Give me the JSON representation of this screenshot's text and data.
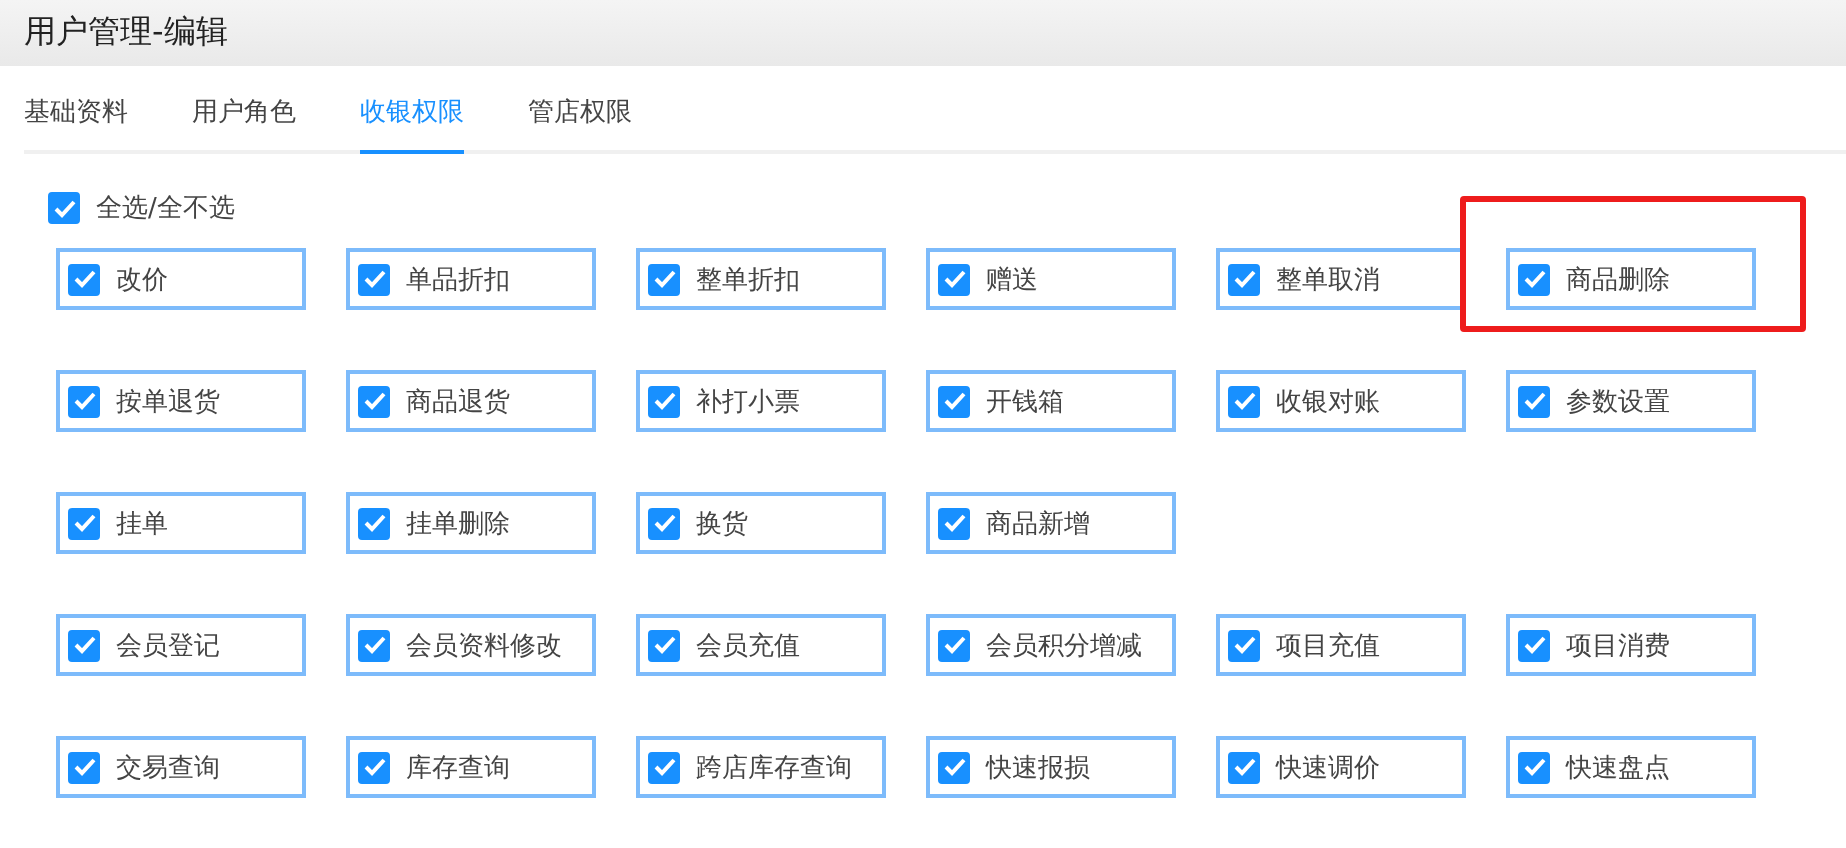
{
  "header": {
    "title": "用户管理-编辑"
  },
  "tabs": [
    {
      "label": "基础资料",
      "selected": false
    },
    {
      "label": "用户角色",
      "selected": false
    },
    {
      "label": "收银权限",
      "selected": true
    },
    {
      "label": "管店权限",
      "selected": false
    }
  ],
  "select_all": {
    "label": "全选/全不选",
    "checked": true
  },
  "permission_rows": [
    [
      {
        "label": "改价",
        "checked": true,
        "highlighted": false
      },
      {
        "label": "单品折扣",
        "checked": true,
        "highlighted": false
      },
      {
        "label": "整单折扣",
        "checked": true,
        "highlighted": false
      },
      {
        "label": "赠送",
        "checked": true,
        "highlighted": false
      },
      {
        "label": "整单取消",
        "checked": true,
        "highlighted": false
      },
      {
        "label": "商品删除",
        "checked": true,
        "highlighted": true
      }
    ],
    [
      {
        "label": "按单退货",
        "checked": true,
        "highlighted": false
      },
      {
        "label": "商品退货",
        "checked": true,
        "highlighted": false
      },
      {
        "label": "补打小票",
        "checked": true,
        "highlighted": false
      },
      {
        "label": "开钱箱",
        "checked": true,
        "highlighted": false
      },
      {
        "label": "收银对账",
        "checked": true,
        "highlighted": false
      },
      {
        "label": "参数设置",
        "checked": true,
        "highlighted": false
      }
    ],
    [
      {
        "label": "挂单",
        "checked": true,
        "highlighted": false
      },
      {
        "label": "挂单删除",
        "checked": true,
        "highlighted": false
      },
      {
        "label": "换货",
        "checked": true,
        "highlighted": false
      },
      {
        "label": "商品新增",
        "checked": true,
        "highlighted": false
      }
    ],
    [
      {
        "label": "会员登记",
        "checked": true,
        "highlighted": false
      },
      {
        "label": "会员资料修改",
        "checked": true,
        "highlighted": false
      },
      {
        "label": "会员充值",
        "checked": true,
        "highlighted": false
      },
      {
        "label": "会员积分增减",
        "checked": true,
        "highlighted": false
      },
      {
        "label": "项目充值",
        "checked": true,
        "highlighted": false
      },
      {
        "label": "项目消费",
        "checked": true,
        "highlighted": false
      }
    ],
    [
      {
        "label": "交易查询",
        "checked": true,
        "highlighted": false
      },
      {
        "label": "库存查询",
        "checked": true,
        "highlighted": false
      },
      {
        "label": "跨店库存查询",
        "checked": true,
        "highlighted": false
      },
      {
        "label": "快速报损",
        "checked": true,
        "highlighted": false
      },
      {
        "label": "快速调价",
        "checked": true,
        "highlighted": false
      },
      {
        "label": "快速盘点",
        "checked": true,
        "highlighted": false
      }
    ]
  ]
}
